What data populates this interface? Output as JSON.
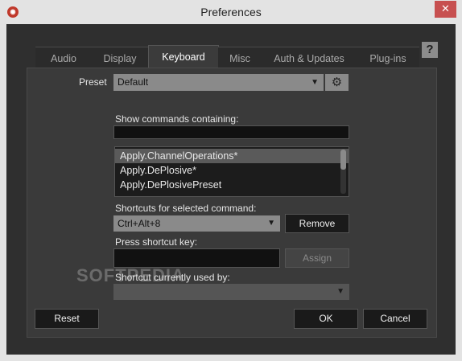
{
  "window": {
    "title": "Preferences",
    "close": "✕"
  },
  "tabs": [
    {
      "label": "Audio"
    },
    {
      "label": "Display"
    },
    {
      "label": "Keyboard",
      "active": true
    },
    {
      "label": "Misc"
    },
    {
      "label": "Auth & Updates"
    },
    {
      "label": "Plug-ins"
    }
  ],
  "help_label": "?",
  "preset": {
    "label": "Preset",
    "value": "Default"
  },
  "filter": {
    "label": "Show commands containing:",
    "value": ""
  },
  "commands": [
    "Apply.ChannelOperations*",
    "Apply.DePlosive*",
    "Apply.DePlosivePreset"
  ],
  "shortcuts": {
    "label": "Shortcuts for selected command:",
    "value": "Ctrl+Alt+8",
    "remove": "Remove"
  },
  "press_key": {
    "label": "Press shortcut key:",
    "value": "",
    "assign": "Assign"
  },
  "used_by": {
    "label": "Shortcut currently used by:",
    "value": ""
  },
  "buttons": {
    "reset": "Reset",
    "ok": "OK",
    "cancel": "Cancel"
  },
  "watermark": "SOFTPEDIA",
  "colors": {
    "close": "#c75050",
    "panel": "#3a3a3a",
    "selection": "#5a5a5a"
  }
}
